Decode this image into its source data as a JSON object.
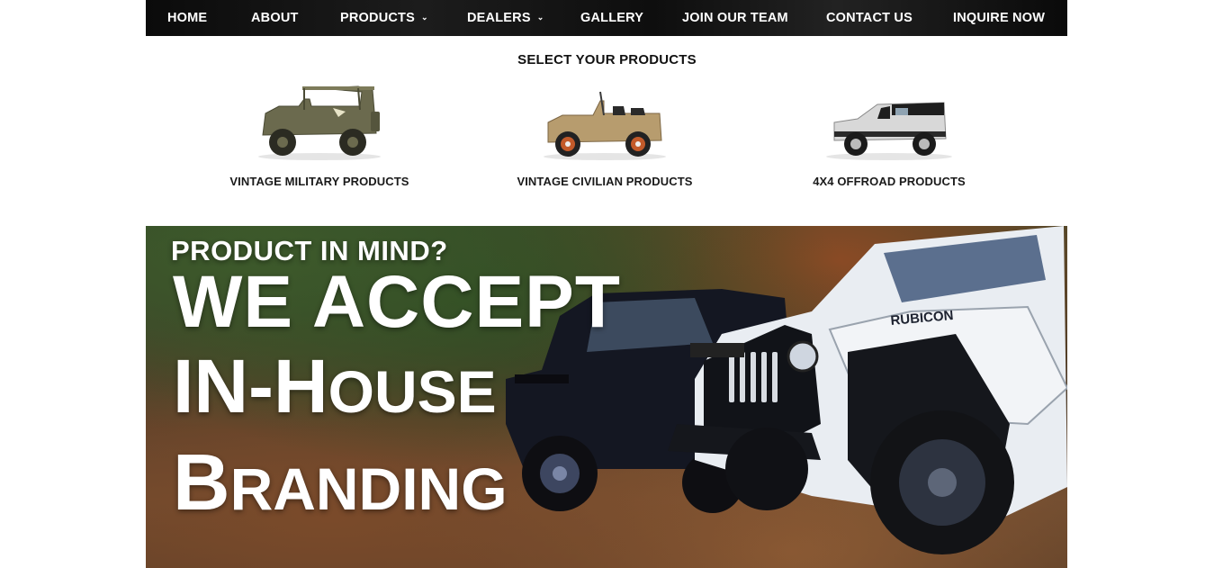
{
  "nav": {
    "items": [
      {
        "label": "HOME",
        "has_dropdown": false
      },
      {
        "label": "ABOUT",
        "has_dropdown": false
      },
      {
        "label": "PRODUCTS",
        "has_dropdown": true
      },
      {
        "label": "DEALERS",
        "has_dropdown": true
      },
      {
        "label": "GALLERY",
        "has_dropdown": false
      },
      {
        "label": "JOIN OUR TEAM",
        "has_dropdown": false
      },
      {
        "label": "CONTACT US",
        "has_dropdown": false
      },
      {
        "label": "INQUIRE NOW",
        "has_dropdown": false
      }
    ],
    "caret_icon": "chevron-down-icon"
  },
  "products": {
    "title": "SELECT YOUR PRODUCTS",
    "items": [
      {
        "label": "VINTAGE MILITARY PRODUCTS",
        "icon": "military-jeep-icon",
        "color": "#6b6a4e"
      },
      {
        "label": "VINTAGE CIVILIAN PRODUCTS",
        "icon": "civilian-jeep-icon",
        "color": "#b79c6e"
      },
      {
        "label": "4X4 OFFROAD PRODUCTS",
        "icon": "offroad-jeep-icon",
        "color": "#d8d8d8"
      }
    ]
  },
  "banner": {
    "line1": "PRODUCT IN MIND?",
    "line2": "WE ACCEPT",
    "line3_big": "IN-H",
    "line3_small": "OUSE",
    "line4_big": "B",
    "line4_small": "RANDING",
    "hood_text": "RUBICON"
  }
}
